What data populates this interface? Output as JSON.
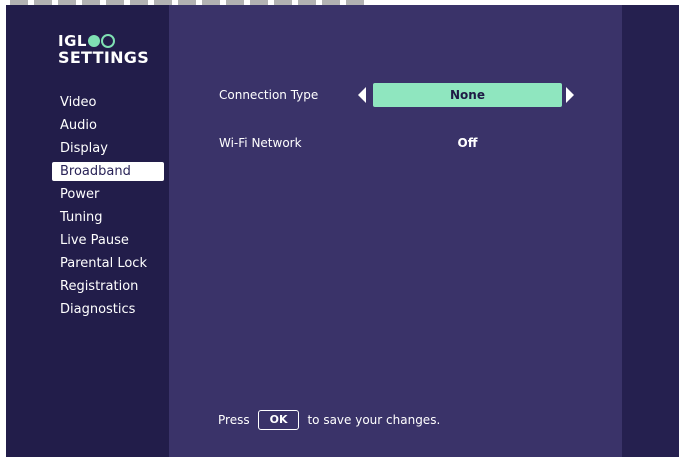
{
  "logo": {
    "line1_prefix": "IGL",
    "line2": "SETTINGS"
  },
  "sidebar": {
    "items": [
      {
        "label": "Video"
      },
      {
        "label": "Audio"
      },
      {
        "label": "Display"
      },
      {
        "label": "Broadband",
        "selected": true
      },
      {
        "label": "Power"
      },
      {
        "label": "Tuning"
      },
      {
        "label": "Live Pause"
      },
      {
        "label": "Parental Lock"
      },
      {
        "label": "Registration"
      },
      {
        "label": "Diagnostics"
      }
    ]
  },
  "settings": {
    "connection_type": {
      "label": "Connection Type",
      "value": "None"
    },
    "wifi_network": {
      "label": "Wi-Fi Network",
      "value": "Off"
    }
  },
  "footer": {
    "prefix": "Press",
    "ok_label": "OK",
    "suffix": "to save your changes."
  },
  "colors": {
    "background": "#25204f",
    "content_panel": "#3a3369",
    "accent": "#8fe6bf",
    "selected_menu_bg": "#ffffff"
  }
}
